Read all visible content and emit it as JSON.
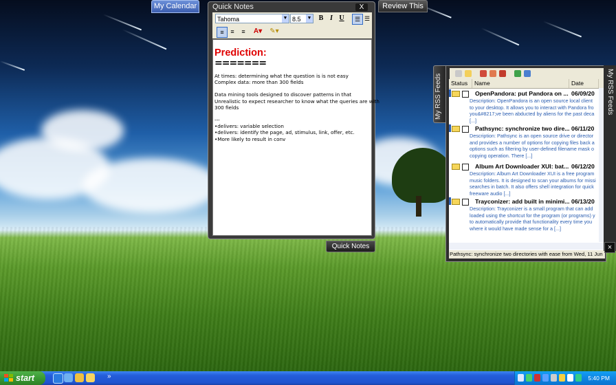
{
  "desktop": {
    "tabs": {
      "calendar": "My Calendar",
      "review": "Review This",
      "quick_notes": "Quick Notes"
    }
  },
  "quick_notes": {
    "title": "Quick Notes",
    "close": "X",
    "font_name": "Tahoma",
    "font_size": "8.5",
    "heading": "Prediction:",
    "heading_rule": "=======",
    "lines": [
      "At times: determining what the question is is not easy",
      "Complex data: more than 300 fields",
      "",
      "Data mining tools designed to discover patterns in that",
      "Unrealistic to expect researcher to know what the queries are with",
      "300 fields",
      "",
      "---",
      "•delivers: variable selection",
      "•delivers: identify the page, ad, stimulus, link, offer, etc.",
      "•More  likely to result in conv"
    ]
  },
  "rss": {
    "side_tab": "My RSS Feeds",
    "right_tab": "My RSS Feeds",
    "close": "×",
    "columns": [
      "Status",
      "Name",
      "Date"
    ],
    "items": [
      {
        "title": "OpenPandora: put Pandora on ...",
        "date": "06/09/20",
        "desc": [
          "Description: OpenPandora is an open source local client",
          "to your desktop. It allows you to interact with Pandora fro",
          "you&#8217;ve been abducted by aliens for the past deca",
          "[...]"
        ]
      },
      {
        "title": "Pathsync: synchronize two dire...",
        "date": "06/11/20",
        "desc": [
          "Description: Pathsync is an open source drive or director",
          "and provides a number of options for copying files back a",
          "options such as filtering by user-defined filename mask o",
          "copying operation. There [...]"
        ]
      },
      {
        "title": "Album Art Downloader XUI: bat...",
        "date": "06/12/20",
        "desc": [
          "Description: Album Art Downloader XUI is a free program",
          "music folders. It is designed to scan your albums for missi",
          "searches in batch. It also offers shell integration for quick",
          "freeware audio [...]"
        ]
      },
      {
        "title": "Trayconizer: add built in minimi...",
        "date": "06/13/20",
        "desc": [
          "Description: Trayconizer is a small program that can add",
          "loaded using the shortcut for the program (or programs) y",
          "to automatically provide that functionality every time you",
          "where it would have made sense for a [...]"
        ]
      }
    ],
    "status_text": "Pathsync: synchronize two directories with ease from Wed, 11 Jun"
  },
  "taskbar": {
    "start_label": "start",
    "quicklaunch_chevron": "»",
    "clock": "5:40 PM"
  },
  "colors": {
    "heading_red": "#e00000",
    "rss_desc_blue": "#2a5db0",
    "taskbar_blue": "#245edb",
    "start_green": "#3a9a33"
  }
}
